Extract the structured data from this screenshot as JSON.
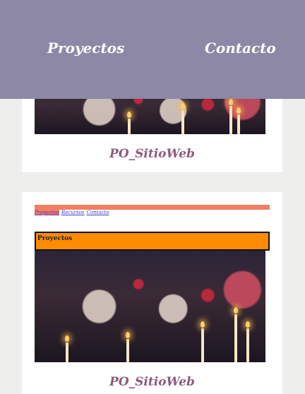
{
  "nav": {
    "items": [
      {
        "label": "Proyectos"
      },
      {
        "label": "Contacto"
      }
    ],
    "background": "#8c88a6"
  },
  "cards": [
    {
      "title": "PO_SitioWeb"
    },
    {
      "title": "PO_SitioWeb",
      "preview": {
        "nav": [
          "Proyectos",
          "Recursos",
          "Contacto"
        ],
        "header_title": "Proyectos"
      }
    }
  ],
  "colors": {
    "accent": "#8e5a7c",
    "preview_bar": "#f08060",
    "preview_header": "#ff8c00"
  }
}
